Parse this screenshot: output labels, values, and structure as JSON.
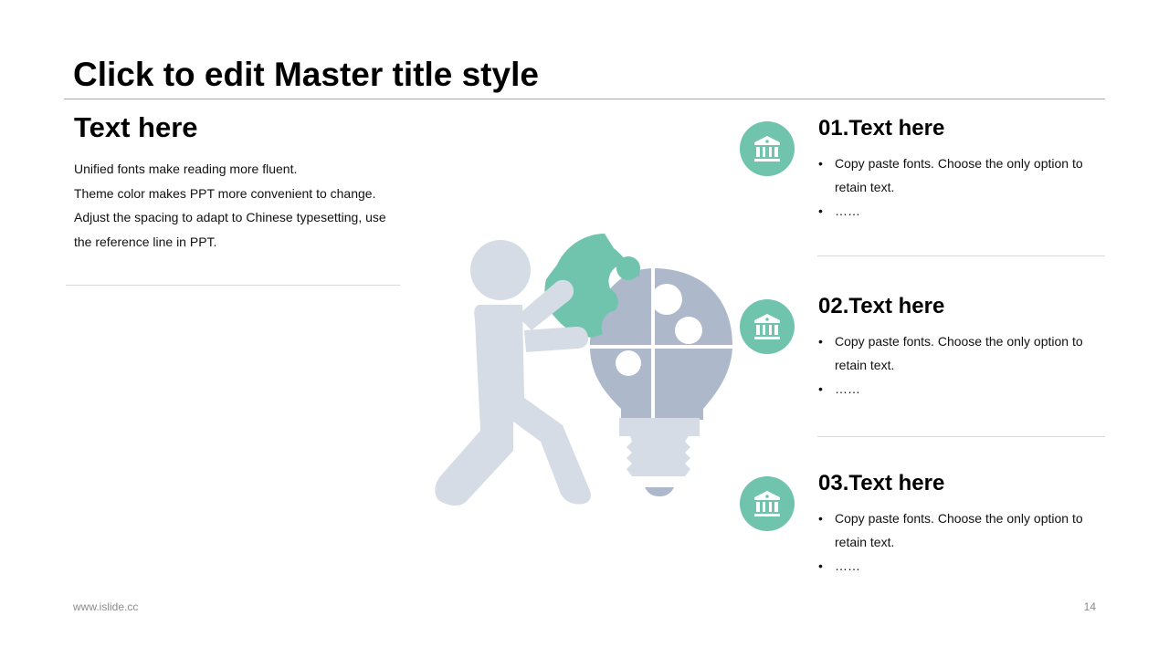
{
  "slide": {
    "title": "Click to edit Master title style"
  },
  "left": {
    "heading": "Text here",
    "lines": [
      "Unified fonts make reading more fluent.",
      "Theme color makes PPT more convenient to change.",
      "Adjust the spacing to adapt to Chinese typesetting, use",
      "the reference line in PPT."
    ]
  },
  "items": [
    {
      "title": "01.Text here",
      "bullets": [
        "Copy paste fonts. Choose the only option to retain text.",
        "……"
      ],
      "icon": "bank-icon"
    },
    {
      "title": "02.Text here",
      "bullets": [
        "Copy paste fonts. Choose the only option to retain text.",
        "……"
      ],
      "icon": "bank-icon"
    },
    {
      "title": "03.Text here",
      "bullets": [
        "Copy paste fonts. Choose the only option to retain text.",
        "……"
      ],
      "icon": "bank-icon"
    }
  ],
  "bullet_symbol": "•",
  "footer": {
    "url": "www.islide.cc",
    "page": "14"
  },
  "colors": {
    "accent": "#70c4ad",
    "figure": "#d6dce5",
    "bulb": "#adb9ca",
    "text": "#000000",
    "muted": "#8c8c8c"
  }
}
